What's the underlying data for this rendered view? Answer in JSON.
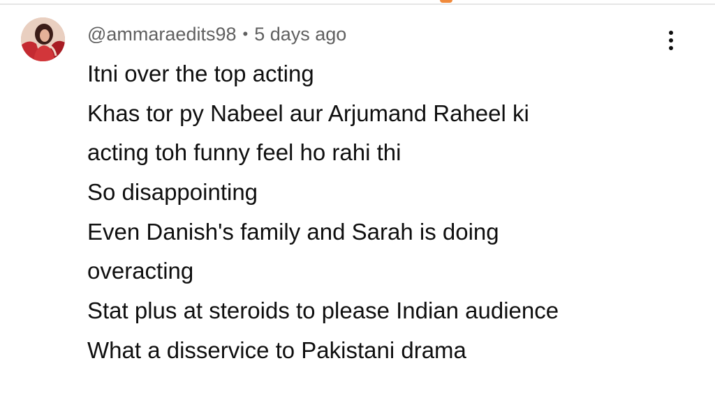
{
  "comment": {
    "username": "@ammaraedits98",
    "separator": "•",
    "timestamp": "5 days ago",
    "lines": [
      "Itni over the top acting",
      "Khas tor py Nabeel aur Arjumand Raheel ki",
      "acting toh funny feel ho rahi thi",
      "So disappointing",
      "Even Danish's family and Sarah is doing",
      "overacting",
      "Stat plus at steroids to please Indian audience",
      "What a disservice to Pakistani drama"
    ],
    "avatar_icon": "user-avatar",
    "menu_icon": "more-vertical-icon"
  },
  "colors": {
    "text": "#0f0f0f",
    "meta": "#606060",
    "accent": "#f08a3c",
    "divider": "#e6e6e6"
  }
}
